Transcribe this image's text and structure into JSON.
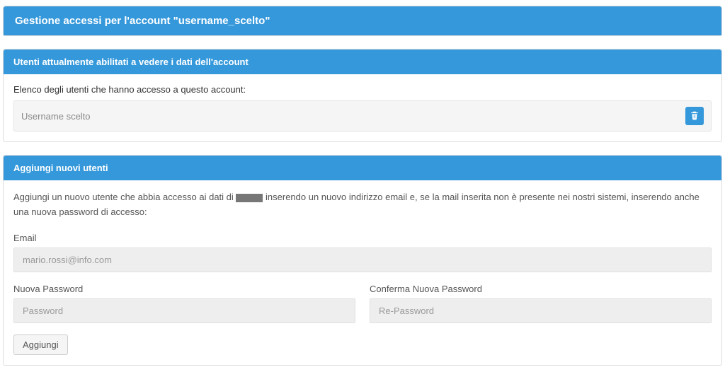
{
  "header": {
    "title_prefix": "Gestione accessi per l'account \"",
    "username": "username_scelto",
    "title_suffix": "\""
  },
  "enabled_users": {
    "panel_title": "Utenti attualmente abilitati a vedere i dati dell'account",
    "list_title": "Elenco degli utenti che hanno accesso a questo account:",
    "list": [
      {
        "name": "Username scelto"
      }
    ]
  },
  "add_users": {
    "panel_title": "Aggiungi nuovi utenti",
    "description_before": "Aggiungi un nuovo utente che abbia accesso ai dati di ",
    "description_after": " inserendo un nuovo indirizzo email e, se la mail inserita non è presente nei nostri sistemi, inserendo anche una nuova password di accesso:",
    "email_label": "Email",
    "email_placeholder": "mario.rossi@info.com",
    "new_password_label": "Nuova Password",
    "new_password_placeholder": "Password",
    "confirm_password_label": "Conferma Nuova Password",
    "confirm_password_placeholder": "Re-Password",
    "add_button": "Aggiungi"
  },
  "colors": {
    "primary": "#3498db"
  }
}
